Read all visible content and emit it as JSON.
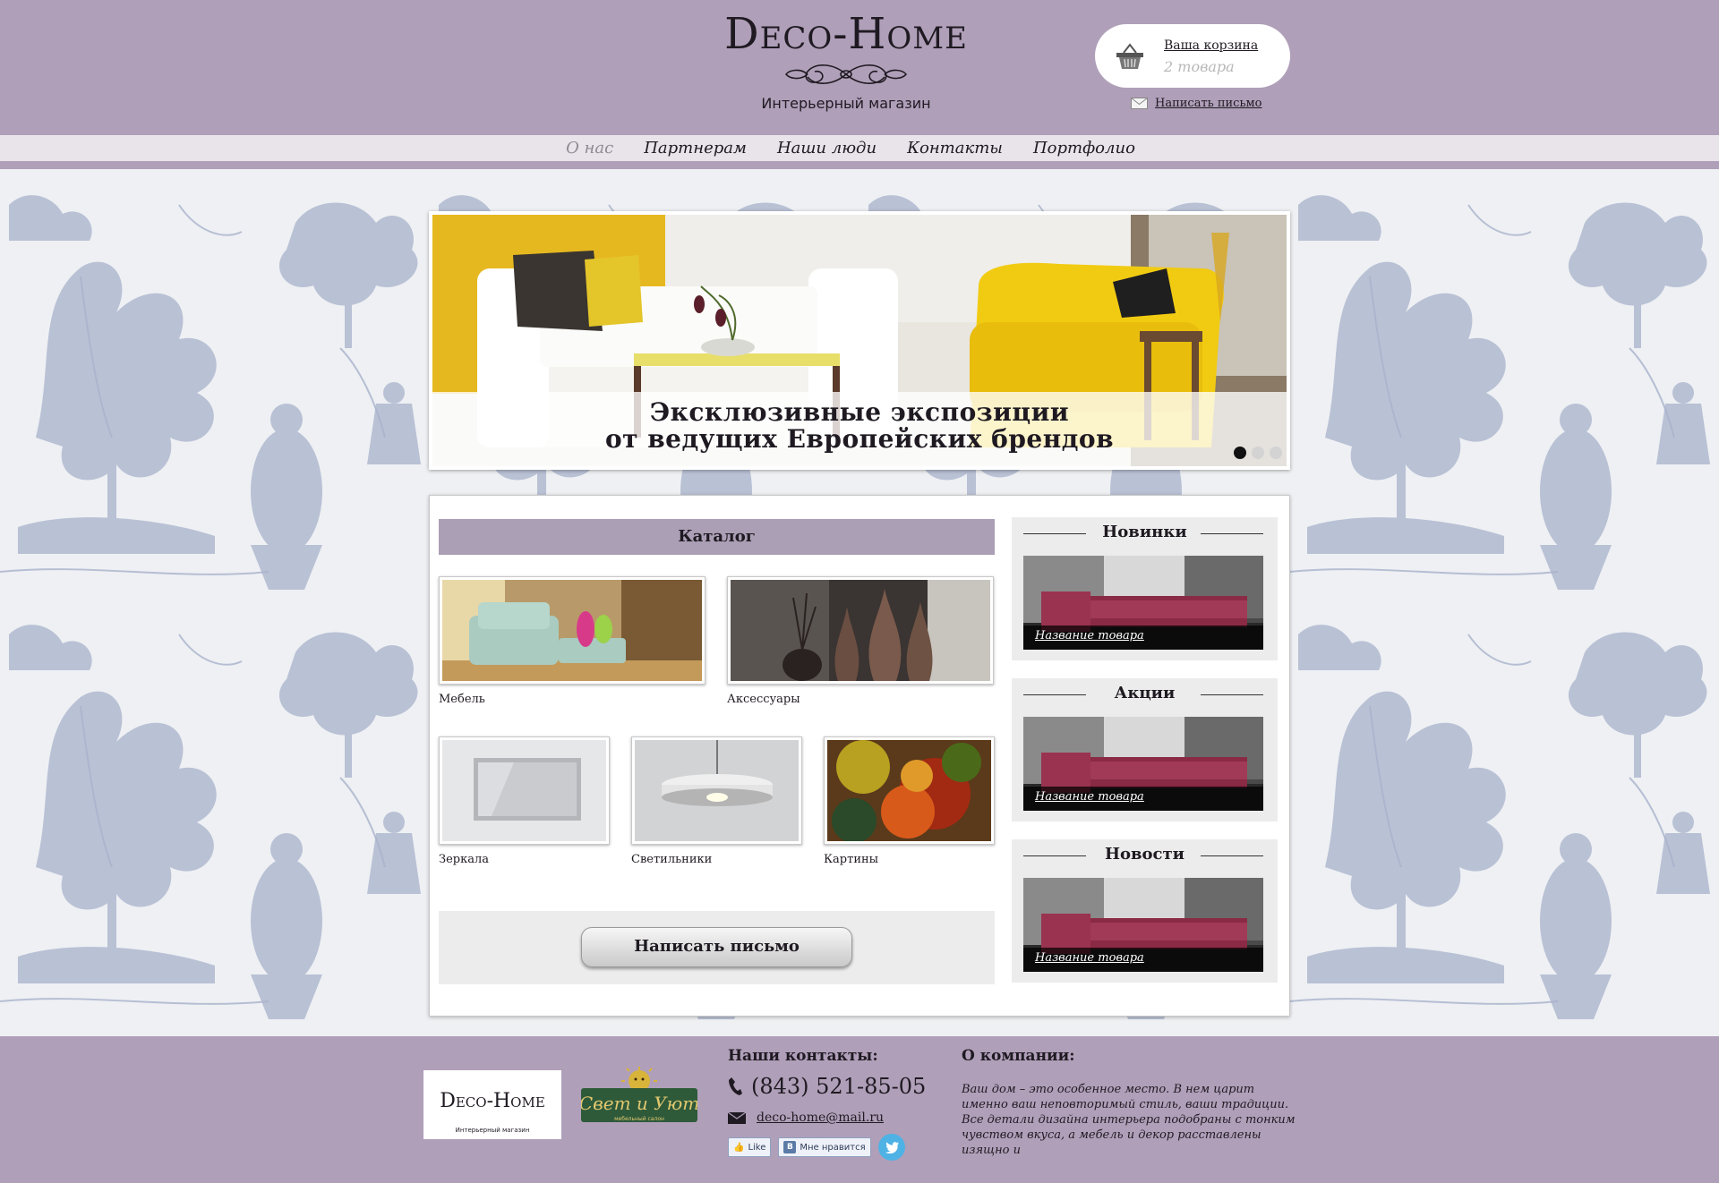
{
  "header": {
    "logo_title": "Deco-Home",
    "logo_subtitle": "Интерьерный магазин",
    "cart_title": "Ваша корзина",
    "cart_count": "2 товара",
    "write_link": "Написать письмо"
  },
  "nav": {
    "items": [
      {
        "label": "О нас",
        "active": true
      },
      {
        "label": "Партнерам",
        "active": false
      },
      {
        "label": "Наши люди",
        "active": false
      },
      {
        "label": "Контакты",
        "active": false
      },
      {
        "label": "Портфолио",
        "active": false
      }
    ]
  },
  "slider": {
    "line1": "Эксклюзивные экспозиции",
    "line2": "от ведущих Европейских брендов",
    "slides_count": 3,
    "active_slide": 1
  },
  "catalog": {
    "title": "Каталог",
    "items": [
      {
        "label": "Мебель",
        "icon": "armchair-photo"
      },
      {
        "label": "Аксессуары",
        "icon": "vases-photo"
      },
      {
        "label": "Зеркала",
        "icon": "mirror-photo"
      },
      {
        "label": "Светильники",
        "icon": "lamp-photo"
      },
      {
        "label": "Картины",
        "icon": "painting-photo"
      }
    ],
    "write_button": "Написать письмо"
  },
  "sidebar": {
    "sections": [
      {
        "title": "Новинки",
        "caption": "Название товара"
      },
      {
        "title": "Акции",
        "caption": "Название товара"
      },
      {
        "title": "Новости",
        "caption": "Название товара"
      }
    ]
  },
  "footer": {
    "logo_title": "Deco-Home",
    "logo_subtitle": "Интерьерный магазин",
    "partner_logo": "Свет и Уют",
    "partner_sub": "мебельный салон",
    "contacts_title": "Наши контакты:",
    "phone": "(843) 521-85-05",
    "email": "deco-home@mail.ru",
    "like_label": "Like",
    "vk_badge": "В",
    "vk_label": "Мне нравится",
    "about_title": "О компании:",
    "about_text": "Ваш дом – это особенное место. В нем царит именно ваш неповторимый стиль, ваши традиции. Все детали дизайна интерьера подобраны с тонким чувством вкуса, а мебель и декор расставлены изящно и"
  },
  "colors": {
    "header_bg": "#b09fb9",
    "catalog_bar": "#ab9fb5",
    "pattern_ink": "#9aa6c2",
    "text_dark": "#1f1a22",
    "active_nav": "#8f8a93"
  }
}
